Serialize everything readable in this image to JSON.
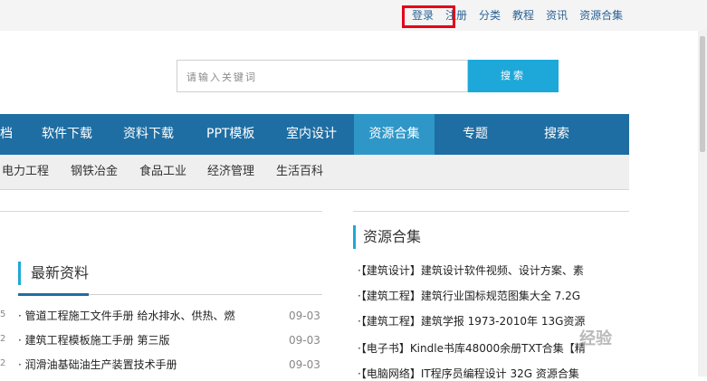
{
  "top_links": [
    "登录",
    "注册",
    "分类",
    "教程",
    "资讯",
    "资源合集"
  ],
  "search": {
    "placeholder": "请输入关键词",
    "button": "搜索"
  },
  "nav": {
    "items": [
      "档",
      "软件下载",
      "资料下载",
      "PPT模板",
      "室内设计",
      "资源合集",
      "专题",
      "搜索"
    ],
    "active": "资源合集"
  },
  "subnav": [
    "电力工程",
    "钢铁冶金",
    "食品工业",
    "经济管理",
    "生活百科"
  ],
  "latest": {
    "title": "最新资料",
    "items": [
      {
        "text": "· 管道工程施工文件手册 给水排水、供热、燃",
        "date": "09-03",
        "stub": "5"
      },
      {
        "text": "· 建筑工程模板施工手册 第三版",
        "date": "09-03",
        "stub": "2"
      },
      {
        "text": "· 润滑油基础油生产装置技术手册",
        "date": "09-03",
        "stub": "2"
      }
    ]
  },
  "resources": {
    "title": "资源合集",
    "items": [
      "·【建筑设计】建筑设计软件视频、设计方案、素",
      "·【建筑工程】建筑行业国标规范图集大全 7.2G",
      "·【建筑工程】建筑学报 1973-2010年 13G资源",
      "·【电子书】Kindle书库48000余册TXT合集【精",
      "·【电脑网络】IT程序员编程设计 32G 资源合集"
    ]
  },
  "watermark": "经验",
  "colors": {
    "nav_bg": "#1f6ea3",
    "nav_active": "#2f97c8",
    "search_btn": "#1ea8d9",
    "highlight_box": "#e3001b"
  }
}
